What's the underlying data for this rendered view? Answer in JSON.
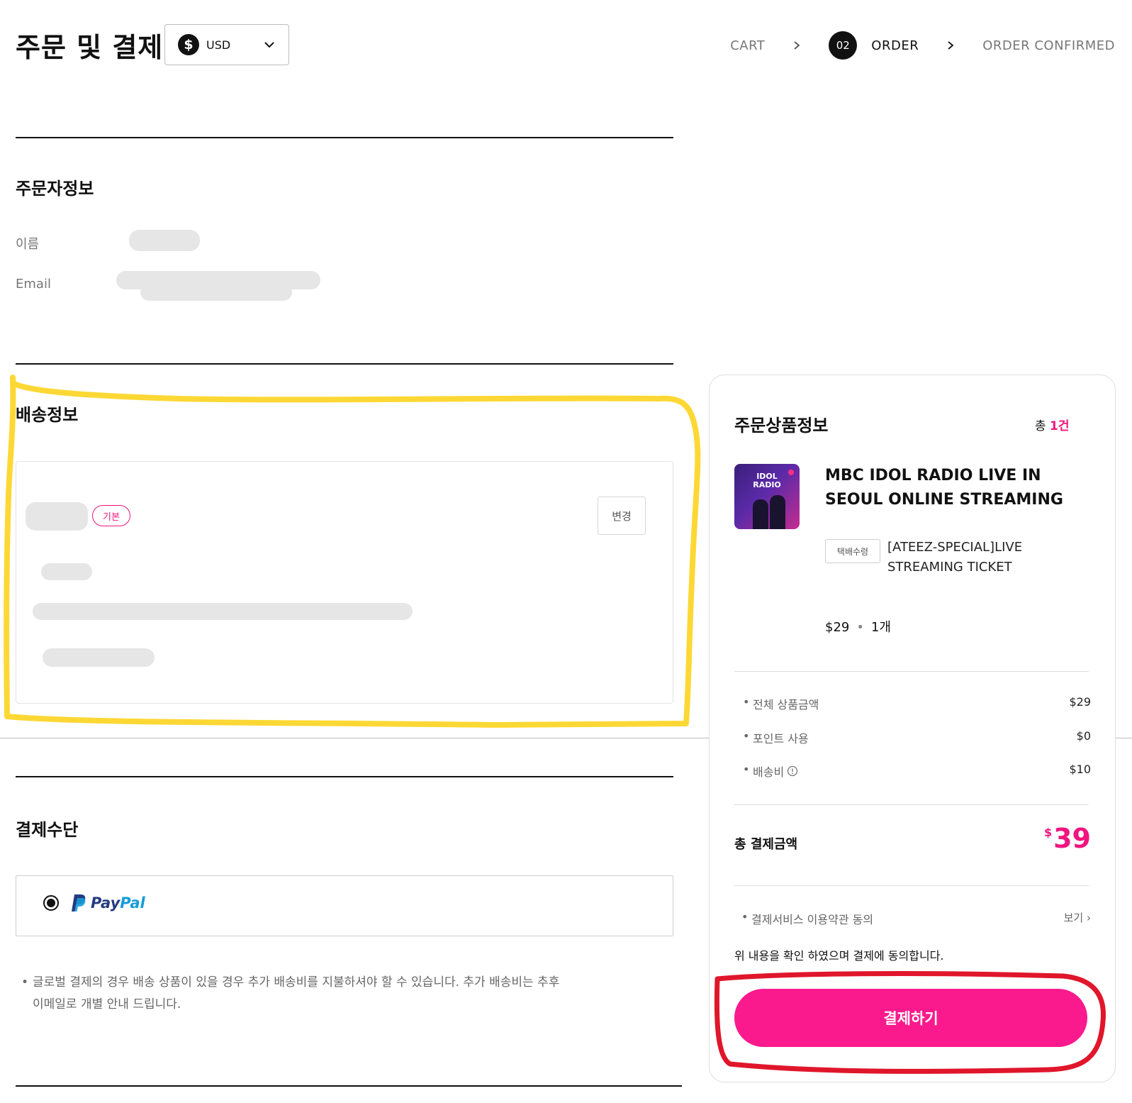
{
  "header": {
    "title": "주문 및 결제",
    "currency_code": "USD",
    "currency_icon": "$",
    "steps": [
      {
        "label": "CART"
      },
      {
        "number": "02",
        "label": "ORDER"
      },
      {
        "label": "ORDER CONFIRMED"
      }
    ]
  },
  "orderer": {
    "title": "주문자정보",
    "name_label": "이름",
    "email_label": "Email"
  },
  "shipping": {
    "title": "배송정보",
    "default_badge": "기본",
    "change_button": "변경"
  },
  "payment": {
    "title": "결제수단",
    "method_text_a": "Pay",
    "method_text_b": "Pal",
    "note_bullet": "•",
    "note": "글로벌 결제의 경우 배송 상품이 있을 경우 추가 배송비를 지불하셔야 할 수 있습니다. 추가 배송비는 추후 이메일로 개별 안내 드립니다."
  },
  "summary": {
    "title": "주문상품정보",
    "count_prefix": "총 ",
    "count_value": "1건",
    "product": {
      "thumb_text_line1": "IDOL",
      "thumb_text_line2": "RADIO",
      "name": "MBC IDOL RADIO LIVE IN SEOUL ONLINE STREAMING",
      "delivery_tag": "택배수령",
      "option": "[ATEEZ-SPECIAL]LIVE STREAMING TICKET",
      "price": "$29",
      "separator": "•",
      "quantity": "1개"
    },
    "lines": [
      {
        "label": "전체 상품금액",
        "value": "$29"
      },
      {
        "label": "포인트 사용",
        "value": "$0"
      },
      {
        "label": "배송비",
        "value": "$10"
      }
    ],
    "total_label": "총 결제금액",
    "total_currency": "$",
    "total_value": "39",
    "terms_label": "결제서비스 이용약관 동의",
    "terms_link": "보기 ›",
    "agree_text": "위 내용을 확인 하였으며 결제에 동의합니다.",
    "pay_button": "결제하기"
  },
  "colors": {
    "accent": "#fb1a8d",
    "highlight_yellow": "#fdd835",
    "highlight_red": "#e0162b"
  }
}
